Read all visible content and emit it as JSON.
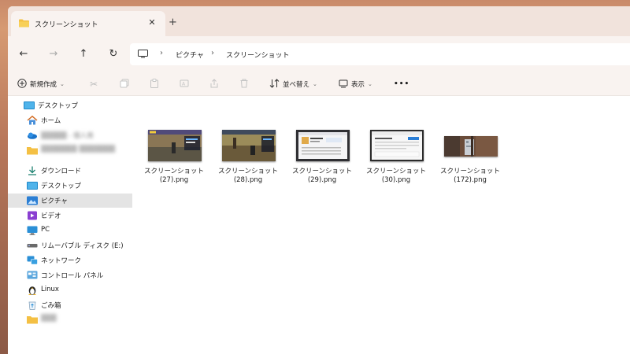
{
  "tab": {
    "title": "スクリーンショット",
    "close": "✕",
    "new_tab": "+"
  },
  "nav": {
    "back": "←",
    "forward": "→",
    "up": "↑",
    "refresh": "↻",
    "breadcrumbs": [
      "ピクチャ",
      "スクリーンショット"
    ],
    "separator": "›"
  },
  "toolbar": {
    "new_label": "新規作成",
    "sort_label": "並べ替え",
    "view_label": "表示",
    "more_label": "•••",
    "caret": "⌄"
  },
  "sidebar": {
    "items": [
      {
        "label": "デスクトップ",
        "icon": "desktop-icon"
      },
      {
        "label": "ホーム",
        "icon": "home-icon"
      },
      {
        "label": "▒▒▒▒▒ - 個人用",
        "icon": "cloud-icon"
      },
      {
        "label": "▒▒▒▒▒▒▒ ▒▒▒▒▒▒▒",
        "icon": "folder-icon"
      },
      {
        "label": "ダウンロード",
        "icon": "download-icon"
      },
      {
        "label": "デスクトップ",
        "icon": "desktop-icon"
      },
      {
        "label": "ピクチャ",
        "icon": "pictures-icon"
      },
      {
        "label": "ビデオ",
        "icon": "video-icon"
      },
      {
        "label": "PC",
        "icon": "pc-icon"
      },
      {
        "label": "リムーバブル ディスク (E:)",
        "icon": "drive-icon"
      },
      {
        "label": "ネットワーク",
        "icon": "network-icon"
      },
      {
        "label": "コントロール パネル",
        "icon": "control-panel-icon"
      },
      {
        "label": "Linux",
        "icon": "linux-icon"
      },
      {
        "label": "ごみ箱",
        "icon": "recycle-bin-icon"
      },
      {
        "label": "▒▒▒",
        "icon": "folder-icon"
      }
    ],
    "selected_index": 6
  },
  "files": [
    {
      "line1": "スクリーンショット",
      "line2": "(27).png",
      "theme": "game"
    },
    {
      "line1": "スクリーンショット",
      "line2": "(28).png",
      "theme": "game"
    },
    {
      "line1": "スクリーンショット",
      "line2": "(29).png",
      "theme": "app"
    },
    {
      "line1": "スクリーンショット",
      "line2": "(30).png",
      "theme": "settings"
    },
    {
      "line1": "スクリーンショット",
      "line2": "(172).png",
      "theme": "room"
    }
  ],
  "colors": {
    "accent": "#0067c0",
    "folder": "#f4c044",
    "tab_bg": "#f9f3f0",
    "strip_bg": "#f1e3dc",
    "selected": "#e4e4e4"
  }
}
